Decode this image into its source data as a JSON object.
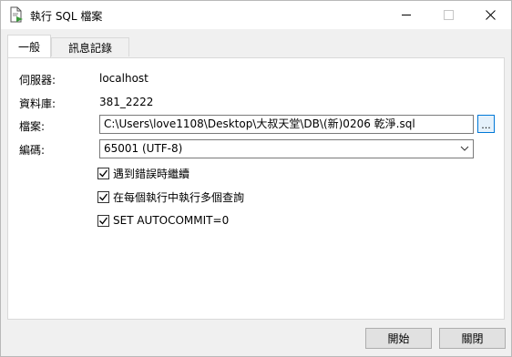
{
  "window": {
    "title": "執行 SQL 檔案"
  },
  "tabs": [
    {
      "label": "一般",
      "active": true
    },
    {
      "label": "訊息記錄",
      "active": false
    }
  ],
  "form": {
    "server_label": "伺服器:",
    "server_value": "localhost",
    "database_label": "資料庫:",
    "database_value": "381_2222",
    "file_label": "檔案:",
    "file_value": "C:\\Users\\love1108\\Desktop\\大叔天堂\\DB\\(新)0206 乾淨.sql",
    "browse_label": "...",
    "encoding_label": "編碼:",
    "encoding_value": "65001 (UTF-8)"
  },
  "options": [
    {
      "label": "遇到錯誤時繼續",
      "checked": true
    },
    {
      "label": "在每個執行中執行多個查詢",
      "checked": true
    },
    {
      "label": "SET AUTOCOMMIT=0",
      "checked": true
    }
  ],
  "buttons": {
    "start": "開始",
    "close": "關閉"
  },
  "icons": {
    "app": "sql-file-run-icon",
    "minimize": "minimize-icon",
    "maximize": "maximize-icon",
    "close": "close-icon",
    "dropdown": "chevron-down-icon",
    "check": "check-icon"
  },
  "colors": {
    "accent": "#0078d7",
    "app_icon_green": "#3c9a3c"
  }
}
